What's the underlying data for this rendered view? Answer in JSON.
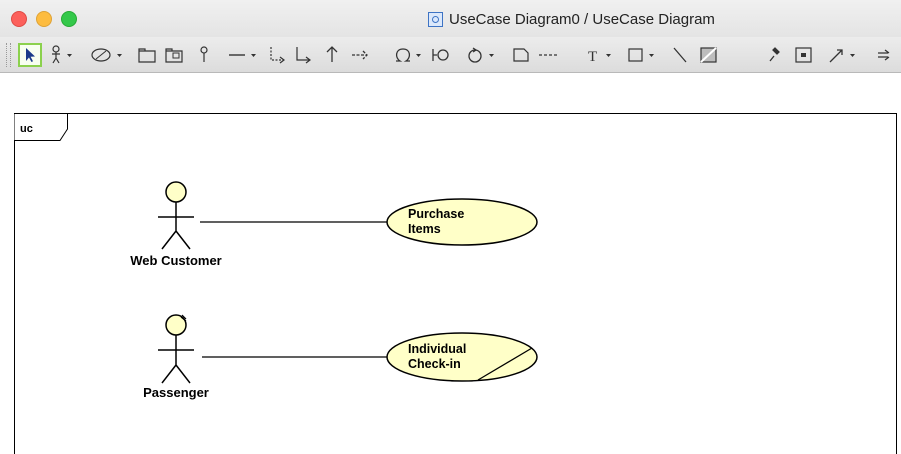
{
  "window": {
    "title": "UseCase Diagram0 / UseCase Diagram"
  },
  "toolbar": {
    "tools": [
      {
        "name": "select-tool",
        "selected": true
      },
      {
        "name": "actor-tool",
        "has_dropdown": true
      },
      {
        "name": "usecase-tool",
        "has_dropdown": true
      },
      {
        "name": "package-tool"
      },
      {
        "name": "subsystem-tool"
      },
      {
        "name": "pin-tool"
      },
      {
        "name": "association-tool",
        "has_dropdown": true
      },
      {
        "name": "extend-tool"
      },
      {
        "name": "include-tool"
      },
      {
        "name": "generalization-tool"
      },
      {
        "name": "dependency-tool"
      },
      {
        "name": "interface-tool",
        "has_dropdown": true
      },
      {
        "name": "realization-tool"
      },
      {
        "name": "control-tool",
        "has_dropdown": true
      },
      {
        "name": "note-tool"
      },
      {
        "name": "note-anchor-tool"
      },
      {
        "name": "text-tool",
        "text": "T",
        "has_dropdown": true
      },
      {
        "name": "rectangle-tool",
        "has_dropdown": true
      },
      {
        "name": "line-tool"
      },
      {
        "name": "image-tool"
      },
      {
        "name": "pin-push-tool"
      },
      {
        "name": "frame-tool"
      },
      {
        "name": "connector-tool",
        "has_dropdown": true
      },
      {
        "name": "more-tool"
      }
    ]
  },
  "diagram": {
    "frame_label": "uc",
    "actors": [
      {
        "label": "Web Customer"
      },
      {
        "label": "Passenger"
      }
    ],
    "usecases": [
      {
        "line1": "Purchase",
        "line2": "Items"
      },
      {
        "line1": "Individual",
        "line2": "Check-in"
      }
    ],
    "colors": {
      "usecase_fill": "#ffffc8",
      "actor_head_fill": "#ffffc8",
      "line": "#000000",
      "selected_tool_border": "#8bd14d"
    }
  }
}
